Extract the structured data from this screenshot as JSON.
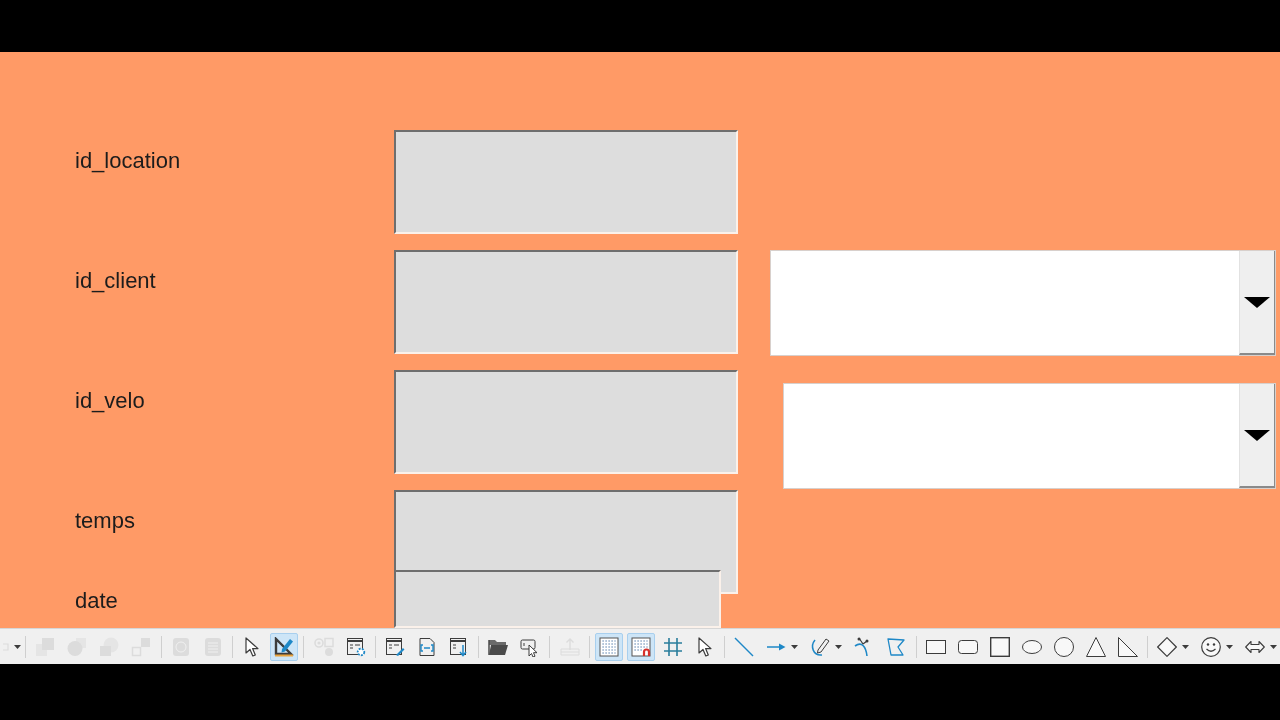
{
  "form": {
    "labels": [
      "id_location",
      "id_client",
      "id_velo",
      "temps",
      "date"
    ],
    "controls": [
      {
        "kind": "text_box"
      },
      {
        "kind": "text_box"
      },
      {
        "kind": "text_box"
      },
      {
        "kind": "text_box"
      },
      {
        "kind": "text_box"
      },
      {
        "kind": "combo_box"
      },
      {
        "kind": "combo_box"
      }
    ]
  },
  "toolbar": {
    "groups": [
      [
        {
          "selected": false,
          "disabled": true,
          "dropdown": true
        }
      ],
      [
        {
          "selected": false,
          "disabled": true,
          "dropdown": false
        },
        {
          "selected": false,
          "disabled": true,
          "dropdown": false
        },
        {
          "selected": false,
          "disabled": true,
          "dropdown": false
        },
        {
          "selected": false,
          "disabled": true,
          "dropdown": false
        }
      ],
      [
        {
          "selected": false,
          "disabled": true,
          "dropdown": false
        },
        {
          "selected": false,
          "disabled": true,
          "dropdown": false
        }
      ],
      [
        {
          "selected": false,
          "disabled": false,
          "dropdown": false
        },
        {
          "selected": true,
          "disabled": false,
          "dropdown": false
        }
      ],
      [
        {
          "selected": false,
          "disabled": true,
          "dropdown": false
        },
        {
          "selected": false,
          "disabled": false,
          "dropdown": false
        }
      ],
      [
        {
          "selected": false,
          "disabled": false,
          "dropdown": false
        },
        {
          "selected": false,
          "disabled": false,
          "dropdown": false
        },
        {
          "selected": false,
          "disabled": false,
          "dropdown": false
        }
      ],
      [
        {
          "selected": false,
          "disabled": false,
          "dropdown": false
        },
        {
          "selected": false,
          "disabled": false,
          "dropdown": false
        }
      ],
      [
        {
          "selected": false,
          "disabled": true,
          "dropdown": false
        }
      ],
      [
        {
          "selected": true,
          "disabled": false,
          "dropdown": false
        },
        {
          "selected": true,
          "disabled": false,
          "dropdown": false
        },
        {
          "selected": false,
          "disabled": false,
          "dropdown": false
        },
        {
          "selected": false,
          "disabled": false,
          "dropdown": false
        }
      ],
      [
        {
          "selected": false,
          "disabled": false,
          "dropdown": false
        },
        {
          "selected": false,
          "disabled": false,
          "dropdown": true
        },
        {
          "selected": false,
          "disabled": false,
          "dropdown": true
        },
        {
          "selected": false,
          "disabled": false,
          "dropdown": false
        },
        {
          "selected": false,
          "disabled": false,
          "dropdown": false
        }
      ],
      [
        {
          "selected": false,
          "disabled": false,
          "dropdown": false
        },
        {
          "selected": false,
          "disabled": false,
          "dropdown": false
        },
        {
          "selected": false,
          "disabled": false,
          "dropdown": false
        },
        {
          "selected": false,
          "disabled": false,
          "dropdown": false
        },
        {
          "selected": false,
          "disabled": false,
          "dropdown": false
        },
        {
          "selected": false,
          "disabled": false,
          "dropdown": false
        },
        {
          "selected": false,
          "disabled": false,
          "dropdown": false
        }
      ],
      [
        {
          "selected": false,
          "disabled": false,
          "dropdown": true
        },
        {
          "selected": false,
          "disabled": false,
          "dropdown": true
        },
        {
          "selected": false,
          "disabled": false,
          "dropdown": true
        }
      ]
    ]
  }
}
